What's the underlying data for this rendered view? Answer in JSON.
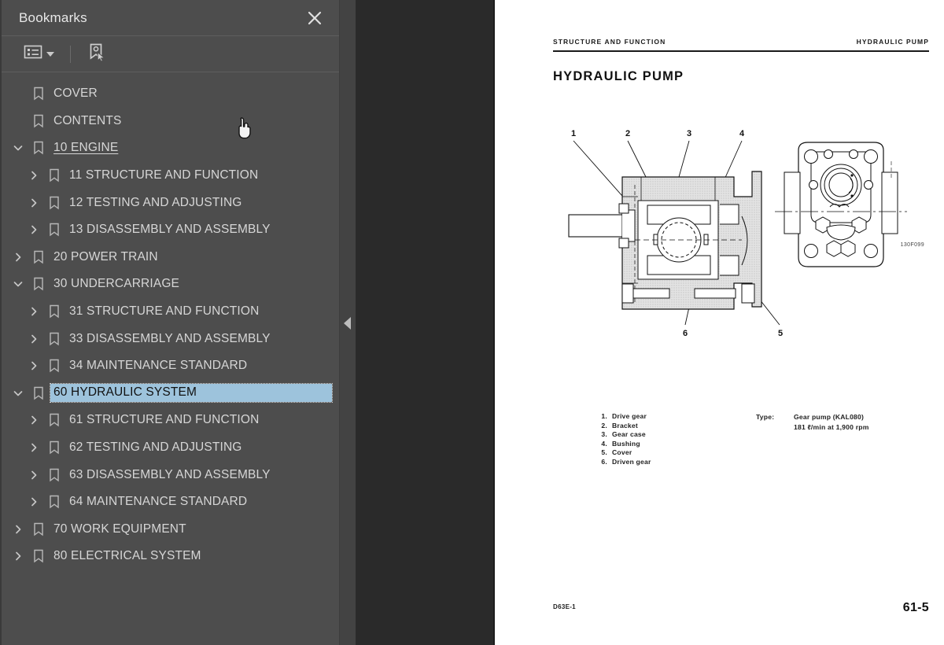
{
  "panel": {
    "title": "Bookmarks",
    "close_icon": "close-icon",
    "toolbar": {
      "options_icon": "list-options-icon",
      "options_caret": "chevron-down-icon",
      "new_bookmark_icon": "new-bookmark-icon"
    }
  },
  "bookmarks": [
    {
      "label": "COVER",
      "depth": 1,
      "twisty": "none",
      "state": "normal"
    },
    {
      "label": "CONTENTS",
      "depth": 1,
      "twisty": "none",
      "state": "normal"
    },
    {
      "label": "10 ENGINE",
      "depth": 1,
      "twisty": "expanded",
      "state": "visited"
    },
    {
      "label": "11 STRUCTURE AND FUNCTION",
      "depth": 2,
      "twisty": "collapsed",
      "state": "normal"
    },
    {
      "label": "12 TESTING AND ADJUSTING",
      "depth": 2,
      "twisty": "collapsed",
      "state": "normal"
    },
    {
      "label": "13 DISASSEMBLY AND ASSEMBLY",
      "depth": 2,
      "twisty": "collapsed",
      "state": "normal"
    },
    {
      "label": "20 POWER TRAIN",
      "depth": 1,
      "twisty": "collapsed",
      "state": "normal"
    },
    {
      "label": "30 UNDERCARRIAGE",
      "depth": 1,
      "twisty": "expanded",
      "state": "normal"
    },
    {
      "label": "31 STRUCTURE AND FUNCTION",
      "depth": 2,
      "twisty": "collapsed",
      "state": "normal"
    },
    {
      "label": "33 DISASSEMBLY AND ASSEMBLY",
      "depth": 2,
      "twisty": "collapsed",
      "state": "normal"
    },
    {
      "label": "34 MAINTENANCE STANDARD",
      "depth": 2,
      "twisty": "collapsed",
      "state": "normal"
    },
    {
      "label": "60 HYDRAULIC SYSTEM",
      "depth": 1,
      "twisty": "expanded",
      "state": "selected"
    },
    {
      "label": "61 STRUCTURE AND FUNCTION",
      "depth": 2,
      "twisty": "collapsed",
      "state": "normal"
    },
    {
      "label": "62 TESTING AND ADJUSTING",
      "depth": 2,
      "twisty": "collapsed",
      "state": "normal"
    },
    {
      "label": "63 DISASSEMBLY AND ASSEMBLY",
      "depth": 2,
      "twisty": "collapsed",
      "state": "normal"
    },
    {
      "label": "64 MAINTENANCE STANDARD",
      "depth": 2,
      "twisty": "collapsed",
      "state": "normal"
    },
    {
      "label": "70 WORK EQUIPMENT",
      "depth": 1,
      "twisty": "collapsed",
      "state": "normal"
    },
    {
      "label": "80 ELECTRICAL SYSTEM",
      "depth": 1,
      "twisty": "collapsed",
      "state": "normal"
    }
  ],
  "splitter": {
    "collapse_icon": "collapse-left-icon"
  },
  "document": {
    "header_left": "STRUCTURE AND FUNCTION",
    "header_right": "HYDRAULIC PUMP",
    "title": "HYDRAULIC PUMP",
    "figure_id": "130F099",
    "callouts": [
      "1",
      "2",
      "3",
      "4",
      "5",
      "6"
    ],
    "legend": [
      {
        "num": "1.",
        "text": "Drive gear"
      },
      {
        "num": "2.",
        "text": "Bracket"
      },
      {
        "num": "3.",
        "text": "Gear case"
      },
      {
        "num": "4.",
        "text": "Bushing"
      },
      {
        "num": "5.",
        "text": "Cover"
      },
      {
        "num": "6.",
        "text": "Driven gear"
      }
    ],
    "spec": {
      "label": "Type:",
      "lines": [
        "Gear pump (KAL080)",
        "181 ℓ/min at 1,900 rpm"
      ]
    },
    "footer_left": "D63E-1",
    "footer_right": "61-5"
  },
  "colors": {
    "sidebar_bg": "#4d4d4d",
    "selection": "#9dc3dc",
    "viewer_bg": "#2a2a2a",
    "splitter_bg": "#434343",
    "text": "#d6d6d6"
  },
  "cursor": {
    "icon": "pointing-hand-cursor"
  }
}
